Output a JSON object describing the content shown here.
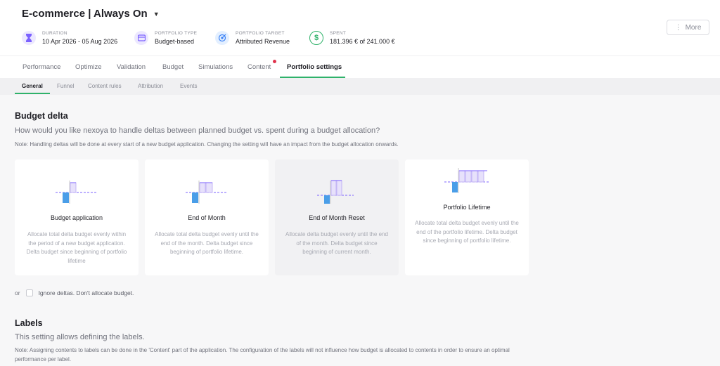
{
  "header": {
    "title": "E-commerce | Always On",
    "more_label": "More",
    "meta": [
      {
        "key": "DURATION",
        "value": "10 Apr 2026 - 05 Aug 2026",
        "icon": "hourglass-icon",
        "color": "#7b61ff"
      },
      {
        "key": "PORTFOLIO TYPE",
        "value": "Budget-based",
        "icon": "wallet-icon",
        "color": "#7b61ff"
      },
      {
        "key": "PORTFOLIO TARGET",
        "value": "Attributed Revenue",
        "icon": "target-icon",
        "color": "#3b82f6"
      },
      {
        "key": "SPENT",
        "value": "181.396 € of 241.000 €",
        "icon": "dollar-icon",
        "color": "#2fb26a"
      }
    ]
  },
  "tabs": [
    "Performance",
    "Optimize",
    "Validation",
    "Budget",
    "Simulations",
    "Content",
    "Portfolio settings"
  ],
  "active_tab": "Portfolio settings",
  "subtabs": [
    "General",
    "Funnel",
    "Content rules",
    "Attribution",
    "Events"
  ],
  "active_subtab": "General",
  "budget_delta": {
    "title": "Budget delta",
    "lead": "How would you like nexoya to handle deltas between planned budget vs. spent during a budget allocation?",
    "note": "Note: Handling deltas will be done at every start of a new budget application. Changing the setting will have an impact from the budget allocation onwards.",
    "options": [
      {
        "title": "Budget application",
        "description": "Allocate total delta budget evenly within the period of a new budget application. Delta budget since beginning of portfolio lifetime"
      },
      {
        "title": "End of Month",
        "description": "Allocate total delta budget evenly until the end of the month. Delta budget since beginning of portfolio lifetime."
      },
      {
        "title": "End of Month Reset",
        "description": "Allocate delta budget evenly until the end of the month. Delta budget since beginning of current month."
      },
      {
        "title": "Portfolio Lifetime",
        "description": "Allocate total delta budget evenly until the end of the portfolio lifetime. Delta budget since beginning of portfolio lifetime."
      }
    ],
    "selected_option": "End of Month Reset",
    "or_label": "or",
    "ignore_label": "Ignore deltas. Don't allocate budget."
  },
  "labels": {
    "title": "Labels",
    "lead": "This setting allows defining the labels.",
    "note": "Note: Assigning contents to labels can be done in the 'Content' part of the application. The configuration of the labels will not influence how budget is allocated to contents in order to ensure an optimal performance per label."
  },
  "colors": {
    "accent_green": "#2fb26a",
    "bar_blue": "#4a9ee8",
    "bar_purple": "#b9a7f5",
    "dash_purple": "#7b61ff"
  }
}
